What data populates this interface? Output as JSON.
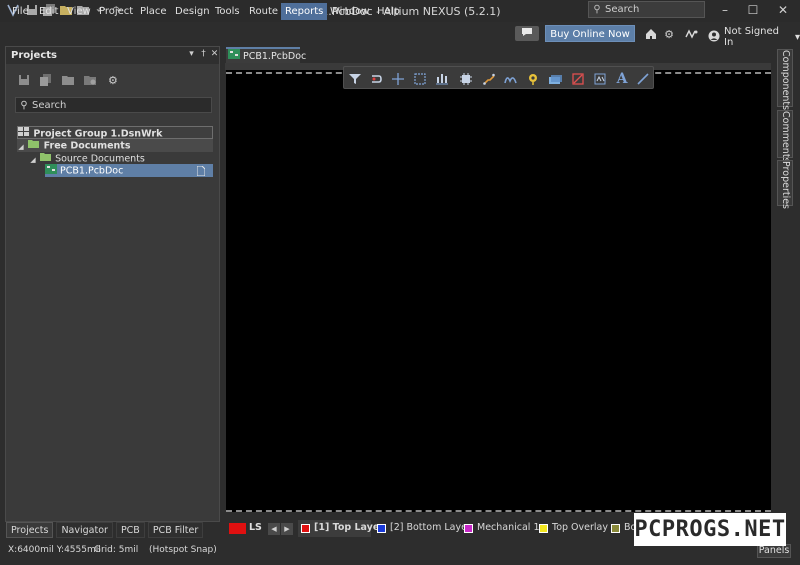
{
  "window": {
    "title": "PCB1.PcbDoc - Altium NEXUS (5.2.1)",
    "search_placeholder": "Search",
    "minimize": "–",
    "maximize": "☐",
    "close": "✕"
  },
  "menu": {
    "items": [
      "File",
      "Edit",
      "View",
      "Project",
      "Place",
      "Design",
      "Tools",
      "Route",
      "Reports",
      "Window",
      "Help"
    ],
    "active": "Reports",
    "buy_online": "Buy Online Now",
    "user": "Not Signed In",
    "user_caret": "▾"
  },
  "projects_panel": {
    "title": "Projects",
    "pin": "▾",
    "dock": "†",
    "close": "✕",
    "search_placeholder": "Search",
    "tree": {
      "group": "Project Group 1.DsnWrk",
      "free_docs": "Free Documents",
      "source_docs": "Source Documents",
      "pcb": "PCB1.PcbDoc"
    },
    "tabs": [
      "Projects",
      "Navigator",
      "PCB",
      "PCB Filter"
    ],
    "active_tab": "Projects"
  },
  "document": {
    "tab_label": "PCB1.PcbDoc"
  },
  "right_tabs": [
    "Components",
    "Comments",
    "Properties"
  ],
  "layers": {
    "ls_label": "LS",
    "current_color": "#e01010",
    "items": [
      {
        "label": "[1] Top Layer",
        "color": "#e01010"
      },
      {
        "label": "[2] Bottom Layer",
        "color": "#1a3ad8"
      },
      {
        "label": "Mechanical 1",
        "color": "#c829c8"
      },
      {
        "label": "Top Overlay",
        "color": "#f2e620"
      },
      {
        "label": "Bo",
        "color": "#8a8a3a"
      }
    ],
    "nav_prev": "◀",
    "nav_next": "▶"
  },
  "status": {
    "coords": "X:6400mil Y:4555mil",
    "grid": "Grid: 5mil",
    "snap": "(Hotspot Snap)",
    "panels": "Panels"
  },
  "watermark": "PCPROGS.NET",
  "colors": {
    "accent": "#5f7fa6",
    "canvas": "#000000",
    "chrome": "#2d2d2d"
  }
}
